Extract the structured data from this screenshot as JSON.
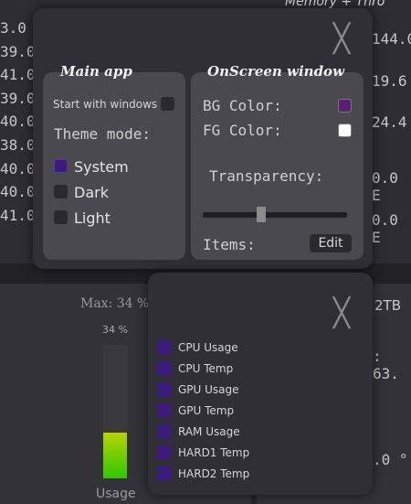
{
  "background": {
    "left_values": [
      "3.0",
      "39.0",
      "41.0",
      "39.0",
      "40.0",
      "38.0",
      "40.0",
      "40.0",
      "41.0"
    ],
    "right_title": "Memory + Thro",
    "right_values": [
      "144.0",
      "19.6",
      "24.4",
      "0.0 E",
      "0.0 E"
    ],
    "max_label": "Max: 34 %",
    "percent_label": "34 %",
    "bar_level": 0.34,
    "usage_label": "Usage",
    "lower_right_title": "2TB",
    "lower_right_values": [
      ": 63.",
      ".0 °"
    ]
  },
  "settings": {
    "main_app": {
      "title": "Main app",
      "start_with_windows_label": "Start with windows",
      "start_with_windows_checked": false,
      "theme_mode_label": "Theme mode:",
      "themes": [
        {
          "label": "System",
          "selected": true
        },
        {
          "label": "Dark",
          "selected": false
        },
        {
          "label": "Light",
          "selected": false
        }
      ]
    },
    "onscreen": {
      "title": "OnScreen window",
      "bg_color_label": "BG Color:",
      "bg_color": "#5b1f6e",
      "fg_color_label": "FG Color:",
      "fg_color": "#ffffff",
      "transparency_label": "Transparency:",
      "transparency_value": 0.4,
      "items_label": "Items:",
      "edit_label": "Edit"
    }
  },
  "items_window": {
    "items": [
      "CPU Usage",
      "CPU Temp",
      "GPU Usage",
      "GPU Temp",
      "RAM Usage",
      "HARD1 Temp",
      "HARD2 Temp"
    ]
  },
  "colors": {
    "accent": "#3a1d7a",
    "panel": "#4a494d",
    "popup": "#302f33",
    "bar_top": "#b8d400",
    "bar_bottom": "#2ec800"
  },
  "icons": [
    "close-icon"
  ]
}
